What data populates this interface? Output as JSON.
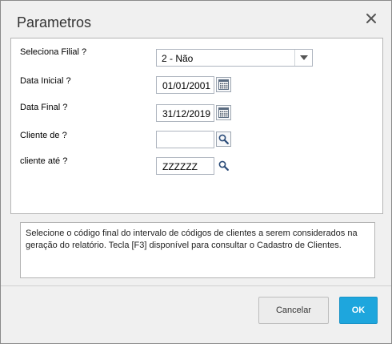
{
  "dialog": {
    "title": "Parametros",
    "close_icon": "close-icon"
  },
  "params": {
    "filial": {
      "label": "Seleciona Filial ?",
      "value": "2 - Não"
    },
    "data_inicial": {
      "label": "Data Inicial ?",
      "value": "01/01/2001"
    },
    "data_final": {
      "label": "Data Final ?",
      "value": "31/12/2019"
    },
    "cliente_de": {
      "label": "Cliente de ?",
      "value": ""
    },
    "cliente_ate": {
      "label": "cliente até ?",
      "value": "ZZZZZZ"
    }
  },
  "help": {
    "text": "Selecione o código final do intervalo de códigos de clientes a serem considerados na geração do relatório. Tecla [F3] disponível para consultar o Cadastro de Clientes."
  },
  "footer": {
    "cancel_label": "Cancelar",
    "ok_label": "OK"
  },
  "colors": {
    "accent": "#1ea6dd",
    "icon": "#2a4b78"
  }
}
